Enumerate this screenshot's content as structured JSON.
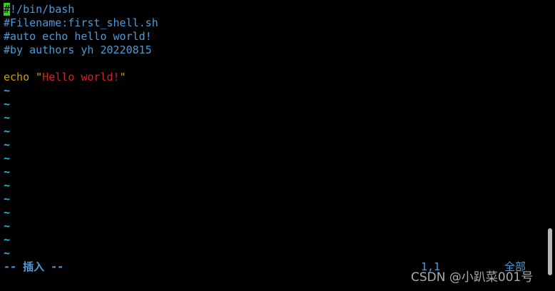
{
  "editor": {
    "cursor_char": "#",
    "line1_rest": "!/bin/bash",
    "line2": "#Filename:first_shell.sh",
    "line3": "#auto echo hello world!",
    "line4": "#by authors yh 20220815",
    "line5": "",
    "echo_keyword": "echo",
    "echo_quote_open": "\"",
    "echo_string": "Hello world!",
    "echo_quote_close": "\"",
    "empty_line_marker": "~"
  },
  "statusbar": {
    "mode": "-- 插入 --",
    "cursor_position": "1,1",
    "scroll_position": "全部"
  },
  "watermark": {
    "text": "CSDN @小趴菜001号"
  },
  "colors": {
    "background": "#000000",
    "comment": "#4d9ad8",
    "cursor": "#29d619",
    "keyword": "#c8a400",
    "string": "#d42323",
    "tilde": "#23b8d6"
  }
}
